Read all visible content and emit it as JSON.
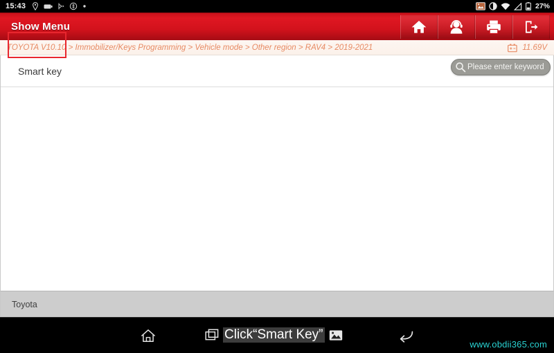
{
  "status_bar": {
    "time": "15:43",
    "battery_percent": "27%",
    "left_icons": [
      "location-pin-icon",
      "capsule-icon",
      "bluetooth-wave-icon",
      "circle-dollar-icon",
      "dot-icon"
    ],
    "right_icons": [
      "screenshot-icon",
      "do-not-disturb-icon",
      "wifi-icon",
      "signal-icon",
      "battery-icon"
    ]
  },
  "title_bar": {
    "title": "Show Menu",
    "buttons": [
      {
        "name": "home-button",
        "icon": "home-icon"
      },
      {
        "name": "support-button",
        "icon": "headset-person-icon"
      },
      {
        "name": "print-button",
        "icon": "printer-icon"
      },
      {
        "name": "exit-button",
        "icon": "exit-door-icon"
      }
    ]
  },
  "breadcrumb": {
    "path": "TOYOTA V10.10 > Immobilizer/Keys Programming > Vehicle mode > Other region > RAV4 > 2019-2021",
    "voltage": "11.69V",
    "battery_icon": "battery-voltage-icon"
  },
  "search": {
    "placeholder": "Please enter keyword",
    "icon": "search-icon"
  },
  "menu": {
    "items": [
      {
        "label": "Smart key",
        "highlighted": true
      }
    ]
  },
  "footer": {
    "label": "Toyota"
  },
  "nav_bar": {
    "home_icon": "home-outline-icon",
    "recents_icon": "recents-squares-icon",
    "back_icon": "back-arrow-icon",
    "screenshot_icon": "image-icon",
    "overlay_text": "Click“Smart Key”"
  },
  "watermark": {
    "text": "www.obdii365.com"
  },
  "colors": {
    "brand_red": "#d2121c",
    "highlight_red": "#e8262e",
    "breadcrumb_text": "#e78a63",
    "watermark_cyan": "#29d2d2",
    "footer_gray": "#cdcdcd"
  }
}
